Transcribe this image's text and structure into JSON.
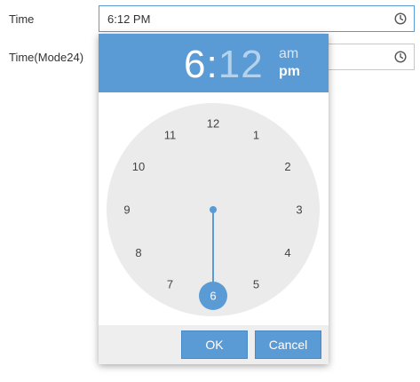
{
  "form": {
    "time_label": "Time",
    "time_value": "6:12 PM",
    "time24_label": "Time(Mode24)",
    "time24_value": ""
  },
  "picker": {
    "hour": "6",
    "colon": ":",
    "minute": "12",
    "am_label": "am",
    "pm_label": "pm",
    "selected_period": "pm",
    "clock_numbers": [
      "12",
      "1",
      "2",
      "3",
      "4",
      "5",
      "6",
      "7",
      "8",
      "9",
      "10",
      "11"
    ],
    "selected_hour": 6,
    "ok_label": "OK",
    "cancel_label": "Cancel"
  },
  "colors": {
    "accent": "#5b9bd5",
    "clock_face": "#ebebeb",
    "footer": "#eeeeee"
  },
  "icons": {
    "field_icon": "clock-icon"
  }
}
